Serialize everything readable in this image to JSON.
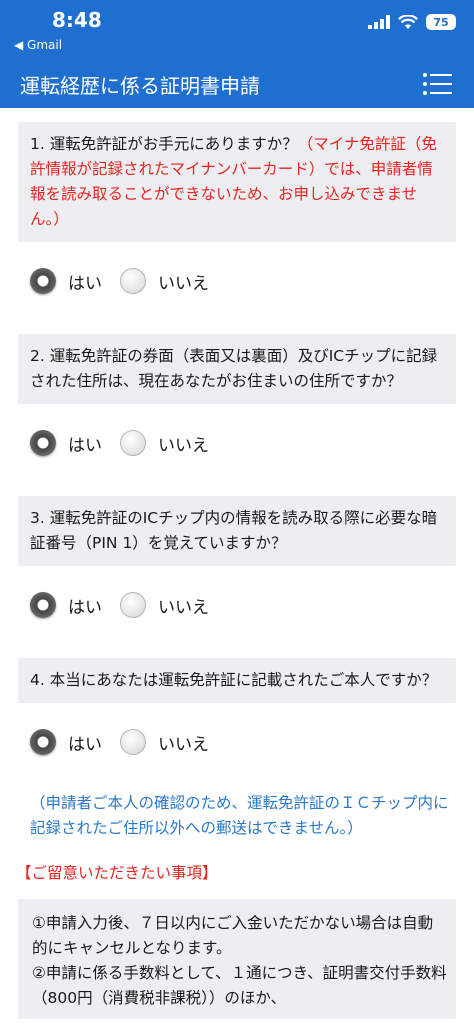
{
  "status_bar": {
    "time": "8:48",
    "back_label": "◀ Gmail",
    "battery": "75"
  },
  "header": {
    "title": "運転経歴に係る証明書申請"
  },
  "questions": [
    {
      "text": "1. 運転免許証がお手元にありますか？",
      "warning": "（マイナ免許証（免許情報が記録されたマイナンバーカード）では、申請者情報を読み取ることができないため、お申し込みできません。）",
      "options": [
        "はい",
        "いいえ"
      ],
      "selected": "はい"
    },
    {
      "text": "2. 運転免許証の券面（表面又は裏面）及びICチップに記録された住所は、現在あなたがお住まいの住所ですか？",
      "options": [
        "はい",
        "いいえ"
      ],
      "selected": "はい"
    },
    {
      "text": "3. 運転免許証のICチップ内の情報を読み取る際に必要な暗証番号（PIN 1）を覚えていますか？",
      "options": [
        "はい",
        "いいえ"
      ],
      "selected": "はい"
    },
    {
      "text": "4. 本当にあなたは運転免許証に記載されたご本人ですか？",
      "options": [
        "はい",
        "いいえ"
      ],
      "selected": "はい"
    }
  ],
  "notice": "（申請者ご本人の確認のため、運転免許証のＩＣチップ内に記録されたご住所以外への郵送はできません。）",
  "notes_title": "【ご留意いただきたい事項】",
  "notes": [
    "①申請入力後、７日以内にご入金いただかない場合は自動的にキャンセルとなります。",
    "②申請に係る手数料として、１通につき、証明書交付手数料（800円（消費税非課税））のほか、"
  ]
}
